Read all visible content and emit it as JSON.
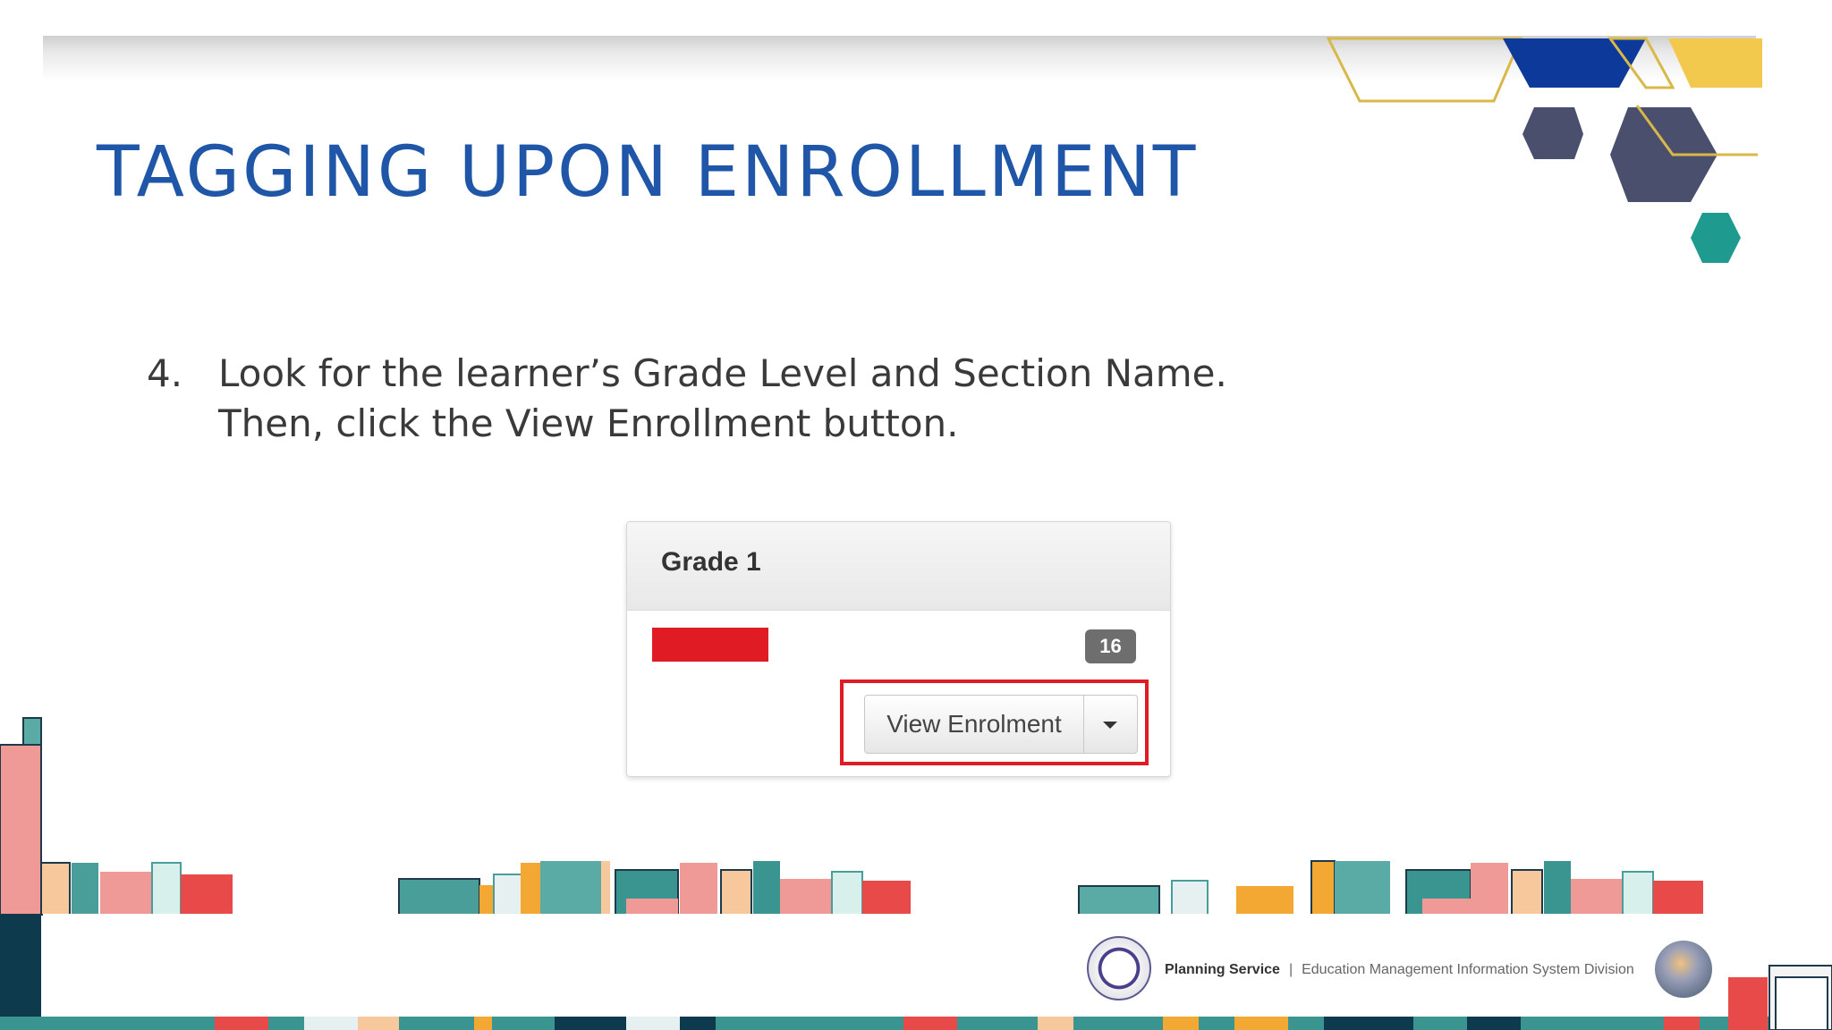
{
  "slide": {
    "title": "TAGGING UPON ENROLLMENT",
    "step_number": "4.",
    "step_line1": "Look for the learner’s Grade Level and Section Name.",
    "step_line2": "Then, click the View Enrollment button."
  },
  "panel": {
    "heading": "Grade 1",
    "count_badge": "16",
    "view_button_label": "View Enrolment",
    "highlight_color": "#e01b24"
  },
  "footer": {
    "office": "Planning Service",
    "separator": "|",
    "division": "Education Management Information System Division"
  },
  "colors": {
    "title": "#1f56a8",
    "teal": "#2a8f8a",
    "navy": "#0d3a9a",
    "gold": "#f2c94c",
    "slate": "#4a4f6e"
  },
  "icons": [
    "caret-down-icon",
    "deped-seal-icon",
    "emis-logo-icon"
  ]
}
